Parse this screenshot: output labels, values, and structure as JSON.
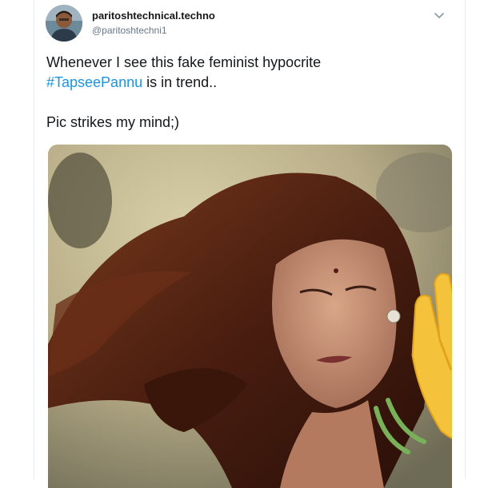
{
  "tweet": {
    "display_name": "paritoshtechnical.techno",
    "handle": "@paritoshtechni1",
    "text_line1": "Whenever I see this fake feminist hypocrite",
    "hashtag": "#TapseePannu",
    "text_line2_rest": " is in trend..",
    "text_line3": "Pic strikes my mind;)",
    "menu_icon": "chevron-down-icon",
    "media_description_icon": "waving-hand-emoji"
  },
  "colors": {
    "hashtag": "#1b95e0",
    "text": "#14171a",
    "handle": "#657786",
    "hand_emoji": "#f5c33b"
  }
}
